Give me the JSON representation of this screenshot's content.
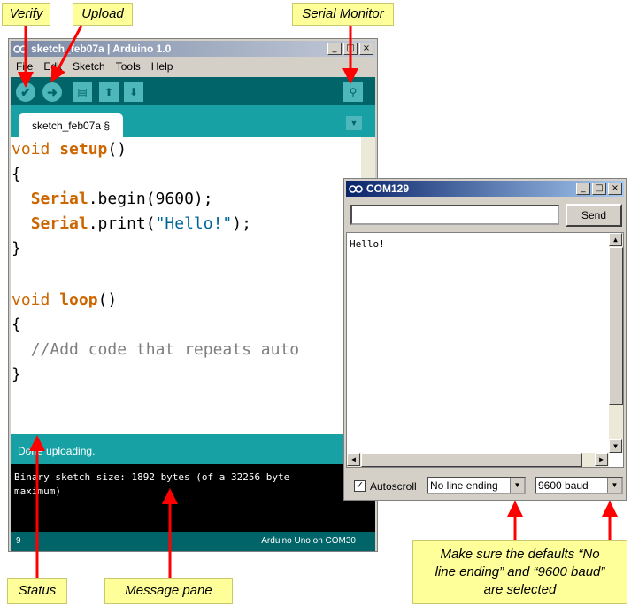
{
  "callouts": {
    "verify": "Verify",
    "upload": "Upload",
    "serial_monitor": "Serial Monitor",
    "status": "Status",
    "message_pane": "Message pane",
    "defaults_note": "Make sure the defaults “No line  ending” and “9600 baud” are selected"
  },
  "ide": {
    "title": "sketch_feb07a | Arduino 1.0",
    "menu": [
      "File",
      "Edit",
      "Sketch",
      "Tools",
      "Help"
    ],
    "tab_label": "sketch_feb07a §",
    "code": {
      "l1_kw": "void",
      "l1_fn": "setup",
      "l1_rest": "()",
      "l2": "{",
      "l3_obj": "Serial",
      "l3_rest": ".begin(9600);",
      "l4_obj": "Serial",
      "l4_mid": ".print(",
      "l4_str": "\"Hello!\"",
      "l4_end": ");",
      "l5": "}",
      "l6_kw": "void",
      "l6_fn": "loop",
      "l6_rest": "()",
      "l7": "{",
      "l8_comment": "//Add code that repeats auto",
      "l9": "}"
    },
    "status_text": "Done uploading.",
    "message_lines": [
      "Binary sketch size: 1892 bytes (of a 32256 byte",
      "maximum)"
    ],
    "line_number": "9",
    "board_port": "Arduino Uno on COM30"
  },
  "serial": {
    "title": "COM129",
    "input_value": "",
    "send_label": "Send",
    "output_text": "Hello!",
    "autoscroll_label": "Autoscroll",
    "autoscroll_checked": true,
    "line_ending": "No line ending",
    "baud": "9600 baud"
  },
  "colors": {
    "arduino_teal_dark": "#006468",
    "arduino_teal": "#17a1a5",
    "callout_yellow": "#ffff99",
    "arrow_red": "#ff0000"
  }
}
